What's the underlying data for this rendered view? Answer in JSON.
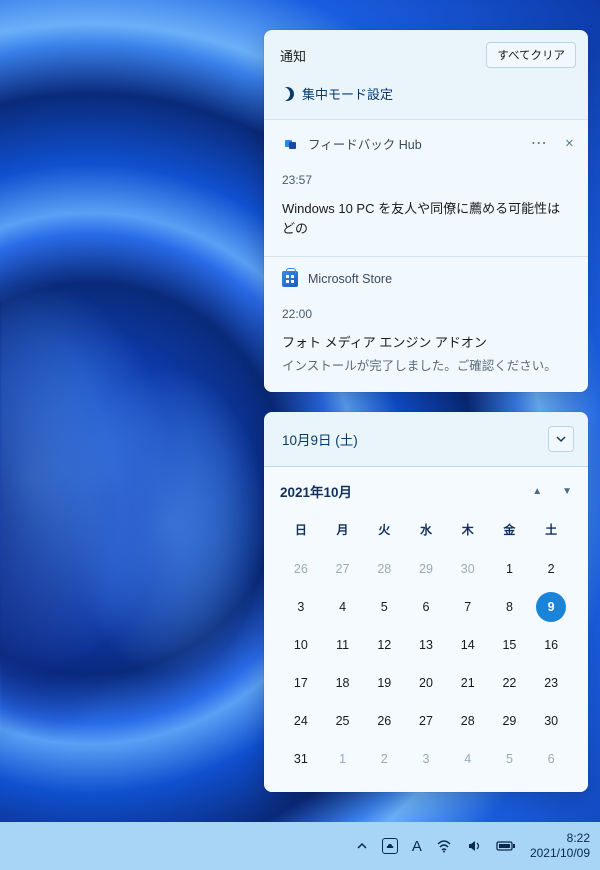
{
  "notifications": {
    "title": "通知",
    "clear_all": "すべてクリア",
    "focus_mode": "集中モード設定",
    "items": [
      {
        "app": "フィードバック Hub",
        "time": "23:57",
        "body": "Windows 10 PC を友人や同僚に薦める可能性はどの"
      },
      {
        "app": "Microsoft Store",
        "time": "22:00",
        "body": "フォト メディア エンジン アドオン",
        "sub": "インストールが完了しました。ご確認ください。"
      }
    ]
  },
  "calendar": {
    "header": "10月9日 (土)",
    "month_label": "2021年10月",
    "dow": [
      "日",
      "月",
      "火",
      "水",
      "木",
      "金",
      "土"
    ],
    "grid": [
      [
        26,
        27,
        28,
        29,
        30,
        1,
        2
      ],
      [
        3,
        4,
        5,
        6,
        7,
        8,
        9
      ],
      [
        10,
        11,
        12,
        13,
        14,
        15,
        16
      ],
      [
        17,
        18,
        19,
        20,
        21,
        22,
        23
      ],
      [
        24,
        25,
        26,
        27,
        28,
        29,
        30
      ],
      [
        31,
        1,
        2,
        3,
        4,
        5,
        6
      ]
    ],
    "today": 9,
    "leading_muted_until": 30,
    "trailing_muted_from_row": 5
  },
  "taskbar": {
    "ime_mode": "A",
    "time": "8:22",
    "date": "2021/10/09"
  }
}
